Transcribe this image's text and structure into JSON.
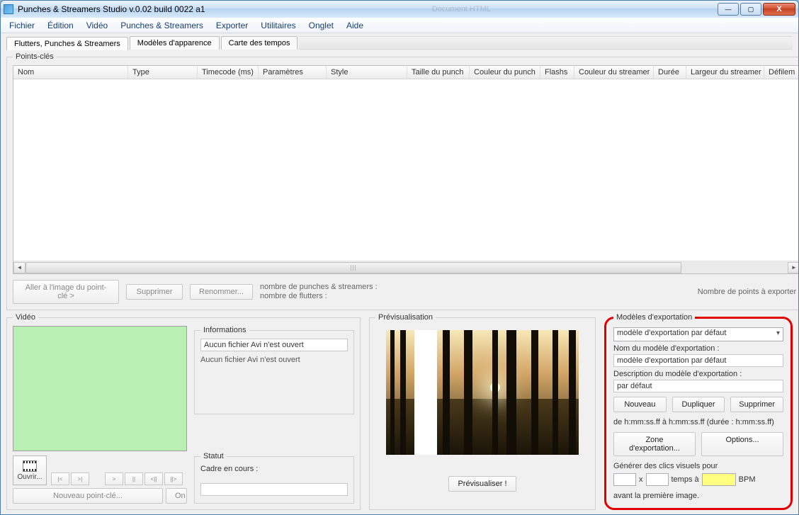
{
  "window": {
    "title": "Punches & Streamers Studio v.0.02 build 0022 a1",
    "faded_bg_text": "Document HTML"
  },
  "menu": [
    "Fichier",
    "Édition",
    "Vidéo",
    "Punches & Streamers",
    "Exporter",
    "Utilitaires",
    "Onglet",
    "Aide"
  ],
  "tabs": [
    "Flutters, Punches & Streamers",
    "Modèles d'apparence",
    "Carte des tempos"
  ],
  "keypoints": {
    "legend": "Points-clés",
    "columns": [
      "Nom",
      "Type",
      "Timecode (ms)",
      "Paramètres",
      "Style",
      "Taille du punch",
      "Couleur du punch",
      "Flashs",
      "Couleur du streamer",
      "Durée",
      "Largeur du streamer",
      "Défilem"
    ],
    "btn_goto": "Aller à l'image du point-clé >",
    "btn_delete": "Supprimer",
    "btn_rename": "Renommer...",
    "count_ps": "nombre de punches & streamers :",
    "count_fl": "nombre de flutters :",
    "export_count": "Nombre de points à exporter :"
  },
  "video": {
    "legend": "Vidéo",
    "info_legend": "Informations",
    "info_field": "Aucun fichier Avi n'est ouvert",
    "info_text": "Aucun fichier Avi n'est ouvert",
    "status_legend": "Statut",
    "status_text": "Cadre en cours :",
    "open": "Ouvrir...",
    "nav": {
      "first": "|<",
      "prev": ">|",
      "next": ">",
      "pause": "||",
      "back": "<||",
      "fwd": "||>"
    },
    "new_kp": "Nouveau point-clé...",
    "on": "On"
  },
  "preview": {
    "legend": "Prévisualisation",
    "btn": "Prévisualiser !"
  },
  "export": {
    "legend": "Modèles d'exportation",
    "select_value": "modèle d'exportation par défaut",
    "name_label": "Nom du modèle d'exportation :",
    "name_value": "modèle d'exportation par défaut",
    "desc_label": "Description du modèle d'exportation :",
    "desc_value": "par défaut",
    "btn_new": "Nouveau",
    "btn_dup": "Dupliquer",
    "btn_del": "Supprimer",
    "de_line": "de h:mm:ss.ff à h:mm:ss.ff (durée : h:mm:ss.ff)",
    "btn_zone": "Zone d'exportation...",
    "btn_opts": "Options...",
    "gen_label": "Générer des clics visuels pour",
    "x": "x",
    "temps_a": "temps à",
    "bpm": "BPM",
    "avant": "avant la première image."
  }
}
